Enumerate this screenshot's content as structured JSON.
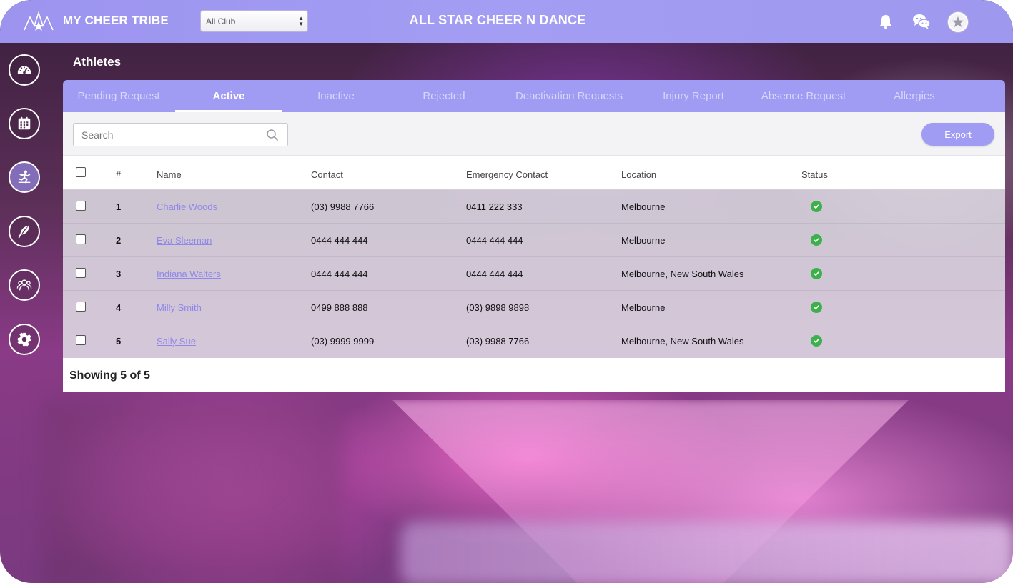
{
  "header": {
    "app_title": "MY CHEER TRIBE",
    "club_select": {
      "value": "All Club"
    },
    "org_title": "ALL STAR CHEER N DANCE",
    "icons": [
      "logo-mark",
      "bell-icon",
      "chat-icon",
      "avatar"
    ]
  },
  "sidebar": {
    "items": [
      {
        "name": "dashboard",
        "icon": "gauge-icon",
        "active": false
      },
      {
        "name": "calendar",
        "icon": "calendar-icon",
        "active": false
      },
      {
        "name": "athletes",
        "icon": "athlete-icon",
        "active": true
      },
      {
        "name": "comms",
        "icon": "feather-icon",
        "active": false
      },
      {
        "name": "groups",
        "icon": "people-icon",
        "active": false
      },
      {
        "name": "settings",
        "icon": "gear-icon",
        "active": false
      }
    ]
  },
  "page": {
    "title": "Athletes"
  },
  "tabs": [
    {
      "label": "Pending Request",
      "active": false
    },
    {
      "label": "Active",
      "active": true
    },
    {
      "label": "Inactive",
      "active": false
    },
    {
      "label": "Rejected",
      "active": false
    },
    {
      "label": "Deactivation Requests",
      "active": false
    },
    {
      "label": "Injury Report",
      "active": false
    },
    {
      "label": "Absence Request",
      "active": false
    },
    {
      "label": "Allergies",
      "active": false
    }
  ],
  "toolbar": {
    "search_placeholder": "Search",
    "export_label": "Export"
  },
  "table": {
    "columns": [
      "#",
      "Name",
      "Contact",
      "Emergency Contact",
      "Location",
      "Status"
    ],
    "rows": [
      {
        "num": "1",
        "name": "Charlie Woods",
        "contact": "(03) 9988 7766",
        "emergency": "0411 222 333",
        "location": "Melbourne",
        "status": "active"
      },
      {
        "num": "2",
        "name": "Eva Sleeman",
        "contact": "0444 444 444",
        "emergency": "0444 444 444",
        "location": "Melbourne",
        "status": "active"
      },
      {
        "num": "3",
        "name": "Indiana Walters",
        "contact": "0444 444 444",
        "emergency": "0444 444 444",
        "location": "Melbourne, New South Wales",
        "status": "active"
      },
      {
        "num": "4",
        "name": "Milly Smith",
        "contact": "0499 888 888",
        "emergency": "(03) 9898 9898",
        "location": "Melbourne",
        "status": "active"
      },
      {
        "num": "5",
        "name": "Sally Sue",
        "contact": "(03) 9999 9999",
        "emergency": "(03) 9988 7766",
        "location": "Melbourne, New South Wales",
        "status": "active"
      }
    ],
    "footer": "Showing 5 of 5"
  },
  "colors": {
    "accent": "#a09bf3",
    "status_active": "#3cb04a",
    "link": "#8f88e8"
  }
}
